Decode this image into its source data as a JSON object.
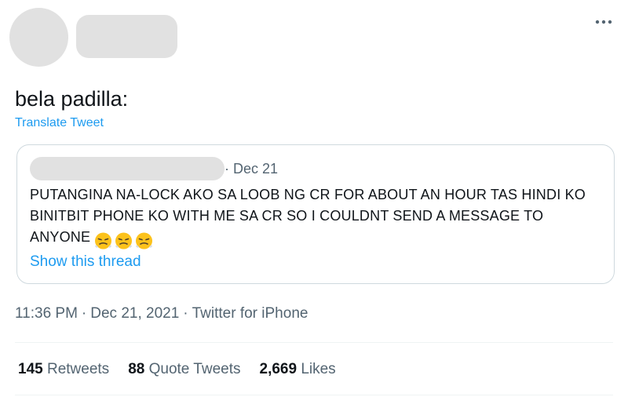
{
  "tweet": {
    "text": "bela padilla:",
    "translate_label": "Translate Tweet",
    "timestamp": "11:36 PM",
    "date": "Dec 21, 2021",
    "source": "Twitter for iPhone"
  },
  "quoted": {
    "date": "· Dec 21",
    "body": "PUTANGINA NA-LOCK AKO SA LOOB NG CR FOR ABOUT AN HOUR TAS HINDI KO BINITBIT PHONE KO WITH ME SA CR SO I COULDNT SEND A MESSAGE TO ANYONE",
    "emoji_icons": [
      "steam-from-nose-face-icon",
      "steam-from-nose-face-icon",
      "steam-from-nose-face-icon"
    ],
    "show_thread_label": "Show this thread"
  },
  "stats": {
    "retweets_count": "145",
    "retweets_label": "Retweets",
    "quotes_count": "88",
    "quotes_label": "Quote Tweets",
    "likes_count": "2,669",
    "likes_label": "Likes"
  },
  "colors": {
    "link": "#1d9bf0",
    "secondary_text": "#536471",
    "placeholder": "#e1e1e1",
    "border": "#cfd9de"
  }
}
